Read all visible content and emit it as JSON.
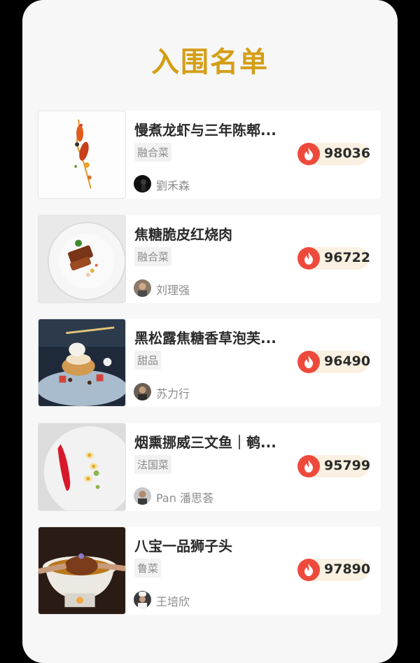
{
  "page": {
    "title": "入围名单"
  },
  "entries": [
    {
      "name": "慢煮龙虾与三年陈郫...",
      "category": "融合菜",
      "heat": "98036",
      "chef": "劉禾森",
      "image": "lobster-dish-image",
      "avatar": "chef-avatar"
    },
    {
      "name": "焦糖脆皮红烧肉",
      "category": "融合菜",
      "heat": "96722",
      "chef": "刘理强",
      "image": "pork-belly-dish-image",
      "avatar": "chef-avatar"
    },
    {
      "name": "黑松露焦糖香草泡芙...",
      "category": "甜品",
      "heat": "96490",
      "chef": "苏力行",
      "image": "puff-dessert-image",
      "avatar": "chef-avatar"
    },
    {
      "name": "烟熏挪威三文鱼｜鹌...",
      "category": "法国菜",
      "heat": "95799",
      "chef": "Pan 潘思荟",
      "image": "salmon-dish-image",
      "avatar": "chef-avatar"
    },
    {
      "name": "八宝一品狮子头",
      "category": "鲁菜",
      "heat": "97890",
      "chef": "王培欣",
      "image": "lion-head-dish-image",
      "avatar": "chef-avatar"
    }
  ],
  "colors": {
    "title": "#d49e15",
    "heat_badge": "#faf1e2",
    "flame": "#ee4a3c"
  },
  "icons": {
    "heat": "flame-icon"
  }
}
